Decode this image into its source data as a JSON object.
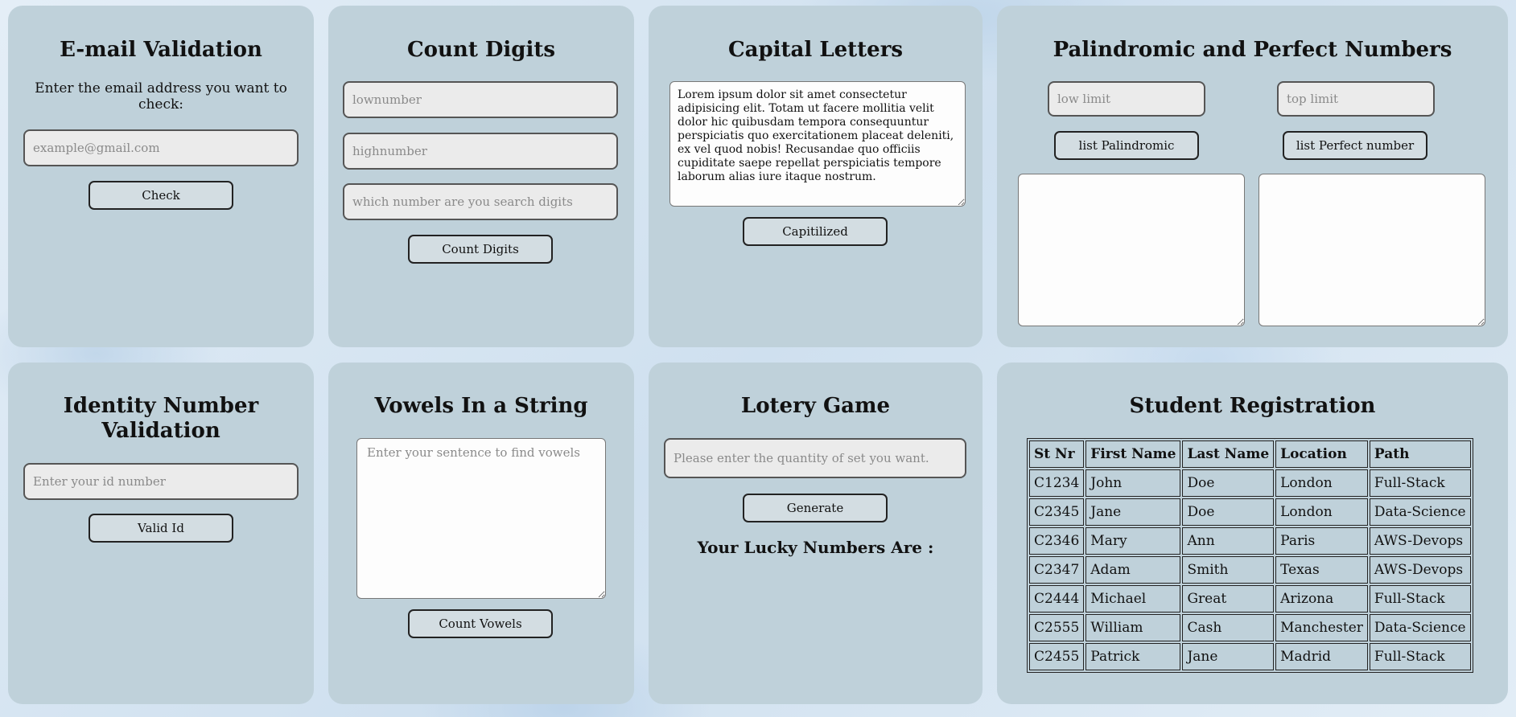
{
  "email": {
    "title": "E-mail Validation",
    "prompt": "Enter the email address you want to check:",
    "placeholder": "example@gmail.com",
    "button": "Check"
  },
  "digits": {
    "title": "Count Digits",
    "low_placeholder": "lownumber",
    "high_placeholder": "highnumber",
    "search_placeholder": "which number are you search digits",
    "button": "Count Digits"
  },
  "capital": {
    "title": "Capital Letters",
    "text": "Lorem ipsum dolor sit amet consectetur adipisicing elit. Totam ut facere mollitia velit dolor hic quibusdam tempora consequuntur perspiciatis quo exercitationem placeat deleniti, ex vel quod nobis! Recusandae quo officiis cupiditate saepe repellat perspiciatis tempore laborum alias iure itaque nostrum.",
    "button": "Capitilized"
  },
  "palindrome": {
    "title": "Palindromic and Perfect Numbers",
    "low_placeholder": "low limit",
    "top_placeholder": "top limit",
    "palindromic_button": "list Palindromic",
    "perfect_button": "list Perfect number"
  },
  "identity": {
    "title": "Identity Number Validation",
    "placeholder": "Enter your id number",
    "button": "Valid Id"
  },
  "vowels": {
    "title": "Vowels In a String",
    "placeholder": "Enter your sentence to find vowels",
    "button": "Count Vowels"
  },
  "lottery": {
    "title": "Lotery Game",
    "placeholder": "Please enter the quantity of set you want.",
    "button": "Generate",
    "result_label": "Your Lucky Numbers Are :"
  },
  "registration": {
    "title": "Student Registration",
    "columns": [
      "St Nr",
      "First Name",
      "Last Name",
      "Location",
      "Path"
    ],
    "rows": [
      [
        "C1234",
        "John",
        "Doe",
        "London",
        "Full-Stack"
      ],
      [
        "C2345",
        "Jane",
        "Doe",
        "London",
        "Data-Science"
      ],
      [
        "C2346",
        "Mary",
        "Ann",
        "Paris",
        "AWS-Devops"
      ],
      [
        "C2347",
        "Adam",
        "Smith",
        "Texas",
        "AWS-Devops"
      ],
      [
        "C2444",
        "Michael",
        "Great",
        "Arizona",
        "Full-Stack"
      ],
      [
        "C2555",
        "William",
        "Cash",
        "Manchester",
        "Data-Science"
      ],
      [
        "C2455",
        "Patrick",
        "Jane",
        "Madrid",
        "Full-Stack"
      ]
    ]
  },
  "colors": {
    "card": "#bfd1da",
    "input": "#ebebeb",
    "button": "#d3dde2"
  }
}
